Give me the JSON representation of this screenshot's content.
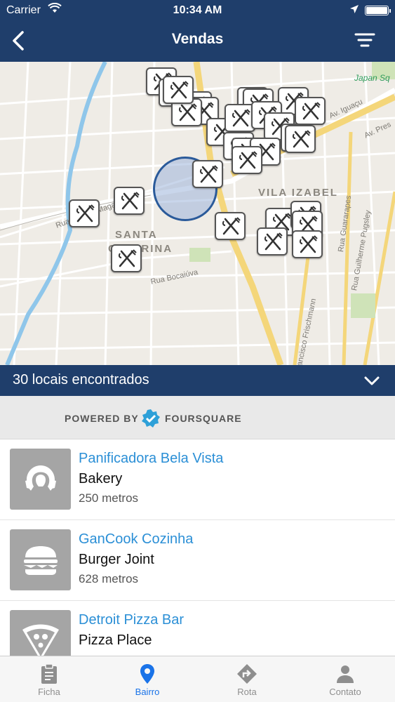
{
  "status": {
    "carrier": "Carrier",
    "time": "10:34 AM"
  },
  "header": {
    "title": "Vendas"
  },
  "map": {
    "districts": [
      "VILA IZABEL",
      "SANTA",
      "CATARINA"
    ],
    "streets": [
      "Rua Menotti Magalhães",
      "Rua Bocaiúva",
      "Av. Iguaçu",
      "Av. Pres",
      "Rua Guararapes",
      "Rua Guilherme Pugsley",
      "Rua Francisco Frischmann"
    ],
    "poi": [
      "Japan Sq"
    ]
  },
  "results": {
    "count_label": "30 locais encontrados"
  },
  "powered": {
    "prefix": "POWERED BY",
    "brand": "FOURSQUARE"
  },
  "venues": [
    {
      "name": "Panificadora Bela Vista",
      "category": "Bakery",
      "distance": "250 metros",
      "icon": "croissant-icon"
    },
    {
      "name": "GanCook Cozinha",
      "category": "Burger Joint",
      "distance": "628 metros",
      "icon": "burger-icon"
    },
    {
      "name": "Detroit Pizza Bar",
      "category": "Pizza Place",
      "distance": "",
      "icon": "pizza-icon"
    }
  ],
  "tabs": [
    {
      "label": "Ficha",
      "icon": "clipboard-icon"
    },
    {
      "label": "Bairro",
      "icon": "location-pin-icon"
    },
    {
      "label": "Rota",
      "icon": "route-icon"
    },
    {
      "label": "Contato",
      "icon": "person-icon"
    }
  ],
  "colors": {
    "navbar": "#1f3e6b",
    "link": "#2b8fd6",
    "active_tab": "#1a73e8",
    "foursquare": "#2ea0d8"
  }
}
